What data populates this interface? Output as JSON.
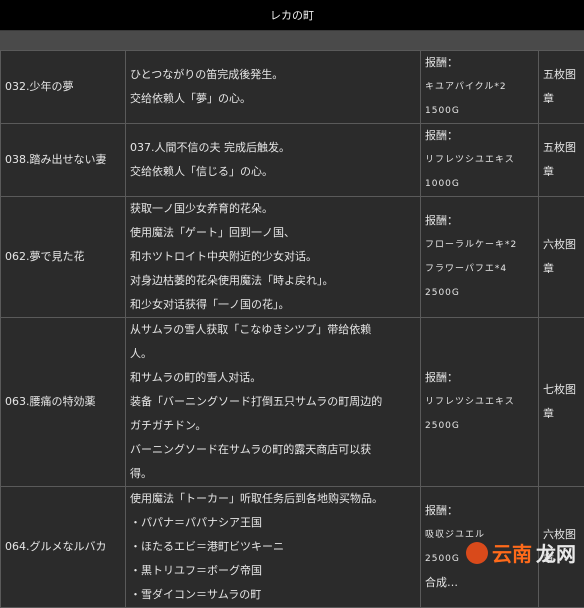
{
  "page": {
    "title": "レカの町"
  },
  "rows": [
    {
      "name": "032.少年の夢",
      "desc": [
        "ひとつながりの笛完成後発生。",
        "交给依赖人「夢」の心。"
      ],
      "reward": [
        "报酬：",
        "キユアパイクル*2",
        "1500G"
      ],
      "image": [
        "五枚图",
        "章"
      ]
    },
    {
      "name": "038.踏み出せない妻",
      "desc": [
        "037.人間不信の夫 完成后触发。",
        "交给依赖人「信じる」の心。"
      ],
      "reward": [
        "报酬：",
        "リフレツシユエキス",
        "1000G"
      ],
      "image": [
        "五枚图",
        "章"
      ]
    },
    {
      "name": "062.夢で見た花",
      "desc": [
        "获取一ノ国少女养育的花朵。",
        "使用魔法「ゲート」回到一ノ国、",
        "和ホツトロイト中央附近的少女对话。",
        "对身边枯萎的花朵使用魔法「時よ戻れ」。",
        "和少女对话获得「一ノ国の花」。"
      ],
      "reward": [
        "报酬：",
        "フローラルケーキ*2",
        "フラワーパフエ*4",
        "2500G"
      ],
      "image": [
        "六枚图",
        "章"
      ]
    },
    {
      "name": "063.腰痛の特効薬",
      "desc": [
        "从サムラの雪人获取「こなゆきシツプ」带给依赖",
        "人。",
        "和サムラの町的雪人对话。",
        "装备「バーニングソード打倒五只サムラの町周边的",
        "ガチガチドン。",
        "バーニングソード在サムラの町的露天商店可以获",
        "得。"
      ],
      "reward": [
        "报酬：",
        "リフレツシユエキス",
        "2500G"
      ],
      "image": [
        "七枚图",
        "章"
      ]
    },
    {
      "name": "064.グルメなルバカ",
      "desc": [
        "使用魔法「トーカー」听取任务后到各地购买物品。",
        "・パパナ＝パパナシア王国",
        "・ほたるエビ＝港町ビツキーニ",
        "・黒トリユフ＝ボーグ帝国",
        "・雪ダイコン＝サムラの町"
      ],
      "reward": [
        "报酬：",
        "吸収ジユエル",
        "2500G",
        "合成…"
      ],
      "image": [
        "六枚图",
        "章"
      ]
    }
  ],
  "watermark": {
    "text_a": "云南",
    "text_b": "龙网"
  }
}
